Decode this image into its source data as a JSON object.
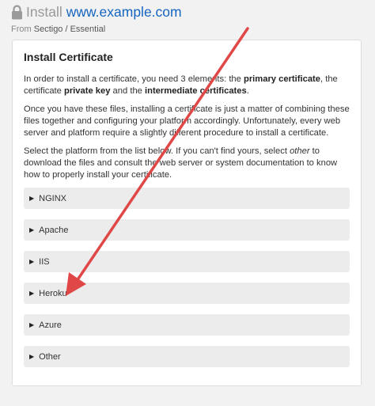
{
  "header": {
    "install_label": "Install",
    "domain": "www.example.com",
    "from_label": "From",
    "breadcrumb": "Sectigo / Essential"
  },
  "card": {
    "title": "Install Certificate",
    "p1": {
      "t1": "In order to install a certificate, you need 3 elements: the ",
      "b1": "primary certificate",
      "t2": ", the certificate ",
      "b2": "private key",
      "t3": " and the ",
      "b3": "intermediate certificates",
      "t4": "."
    },
    "p2": "Once you have these files, installing a certificate is just a matter of combining these files together and configuring your platform accordingly. Unfortunately, every web server and platform require a slightly different procedure to install a certificate.",
    "p3": {
      "t1": "Select the platform from the list below. If you can't find yours, select ",
      "i1": "other",
      "t2": " to download the files and consult the web server or system documentation to know how to properly install your certificate."
    }
  },
  "platforms": [
    {
      "label": "NGINX"
    },
    {
      "label": "Apache"
    },
    {
      "label": "IIS"
    },
    {
      "label": "Heroku"
    },
    {
      "label": "Azure"
    },
    {
      "label": "Other"
    }
  ],
  "colors": {
    "link": "#1565c0",
    "annotation_arrow": "#e04848",
    "accordion_bg": "#ececec"
  },
  "icons": {
    "lock": "lock-icon",
    "expand": "caret-right-icon"
  }
}
